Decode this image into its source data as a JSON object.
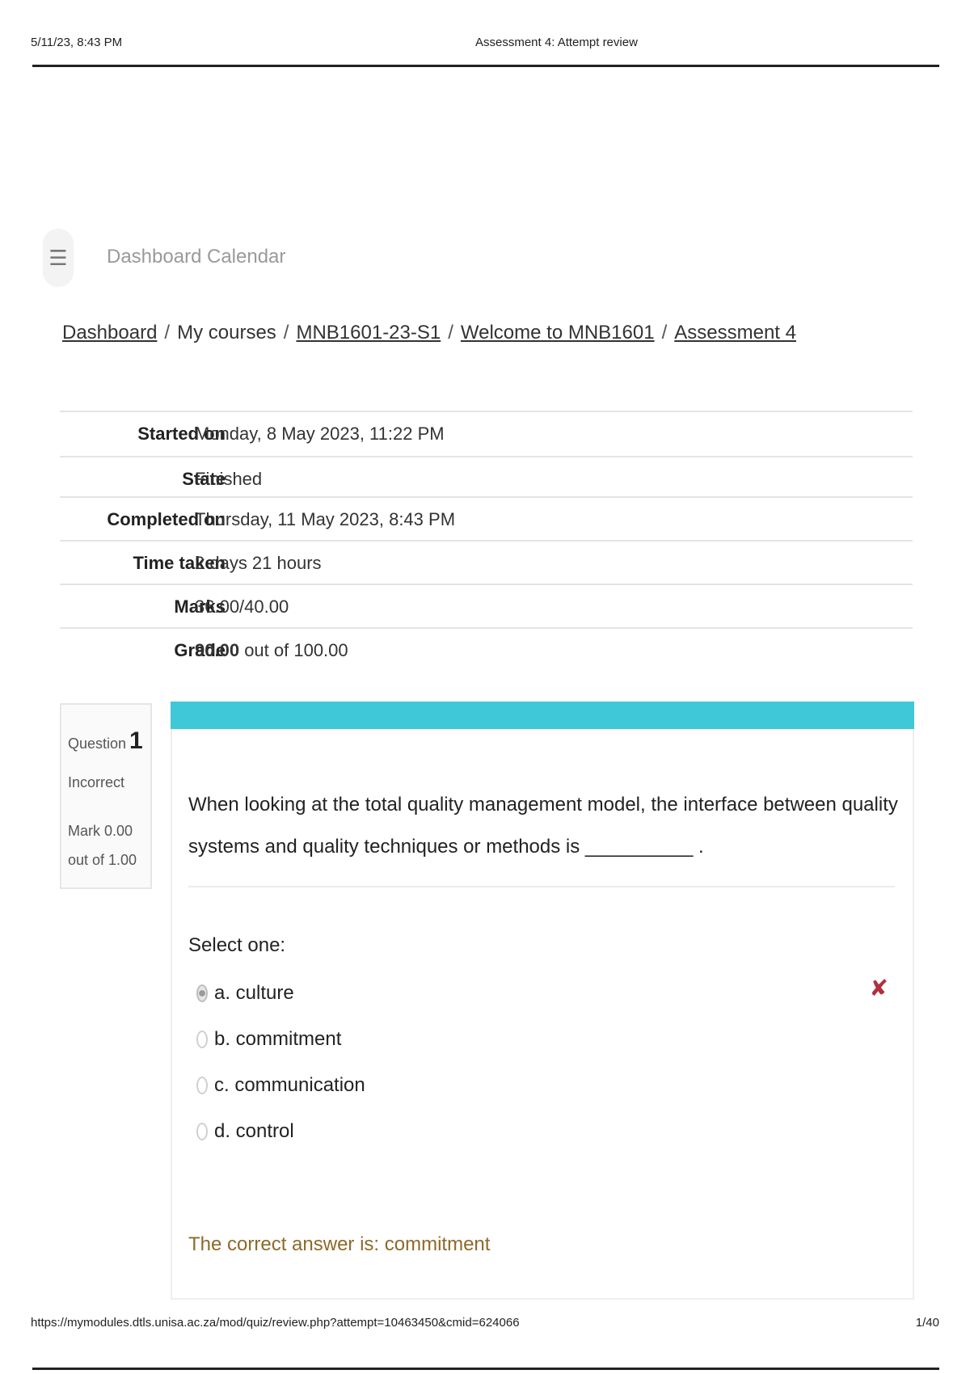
{
  "print_header": {
    "datetime": "5/11/23, 8:43 PM",
    "title": "Assessment 4: Attempt review"
  },
  "nav": {
    "toggle_icon": "hamburger-icon",
    "items": [
      "Dashboard",
      "Calendar"
    ]
  },
  "breadcrumb": {
    "items": [
      "Dashboard",
      "My courses",
      "MNB1601-23-S1",
      "Welcome to MNB1601",
      "Assessment 4"
    ],
    "separator": "/"
  },
  "summary": {
    "started_on": {
      "label": "Started on",
      "value": "Monday, 8 May 2023, 11:22 PM"
    },
    "state": {
      "label": "State",
      "value": "Finished"
    },
    "completed_on": {
      "label": "Completed on",
      "value": "Thursday, 11 May 2023, 8:43 PM"
    },
    "time_taken": {
      "label": "Time taken",
      "value": "2 days 21 hours"
    },
    "marks": {
      "label": "Marks",
      "value": "36.00/40.00"
    },
    "grade": {
      "label": "Grade",
      "value_bold": "90.00",
      "value_rest": "out of 100.00"
    }
  },
  "question": {
    "label": "Question",
    "number": "1",
    "status": "Incorrect",
    "mark": "Mark 0.00 out of 1.00",
    "text": "When looking at the total quality management model, the interface between quality systems and quality techniques or methods is __________ .",
    "prompt": "Select one:",
    "options": [
      {
        "label": "a. culture",
        "selected": true
      },
      {
        "label": "b. commitment",
        "selected": false
      },
      {
        "label": "c. communication",
        "selected": false
      },
      {
        "label": "d. control",
        "selected": false
      }
    ],
    "wrong_icon": "cross-icon",
    "wrong_mark": "✘",
    "correct_answer": "The correct answer is: commitment",
    "accent_color": "#3ec8d8",
    "feedback_color": "#8d6a28"
  },
  "print_footer": {
    "url": "https://mymodules.dtls.unisa.ac.za/mod/quiz/review.php?attempt=10463450&cmid=624066",
    "page": "1/40"
  }
}
